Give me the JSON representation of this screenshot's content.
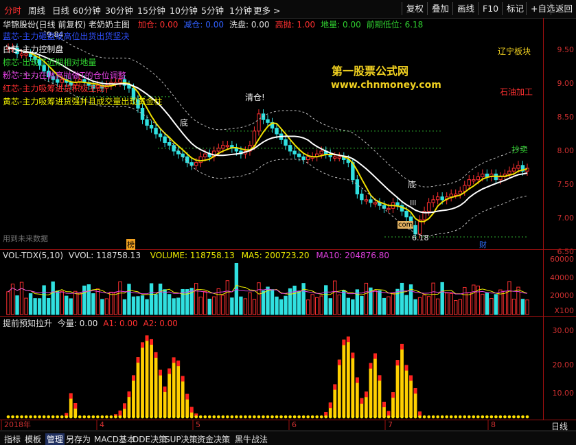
{
  "period_tabs": [
    "分时",
    "周线",
    "日线",
    "60分钟",
    "30分钟",
    "15分钟",
    "10分钟",
    "5分钟",
    "1分钟",
    "更多 >"
  ],
  "active_period": "分时",
  "toolbar_right": [
    "复权",
    "叠加",
    "画线",
    "F10",
    "标记",
    "+自选",
    "返回"
  ],
  "main": {
    "title": "华锦股份(日线 前复权) 老奶奶主图",
    "indicators": [
      {
        "label": "加仓: 0.00",
        "color": "#ff3030"
      },
      {
        "label": "减仓: 0.00",
        "color": "#3060ff"
      },
      {
        "label": "洗盘: 0.00",
        "color": "#e0e0e0"
      },
      {
        "label": "高抛: 1.00",
        "color": "#ff3030"
      },
      {
        "label": "地量: 0.00",
        "color": "#30d030"
      },
      {
        "label": "前期低位: 6.18",
        "color": "#30d030"
      }
    ],
    "legend": [
      {
        "text": "蓝芯-主力砸盘或高位出货出货坚决",
        "color": "#3050ff"
      },
      {
        "text": "白芯-主力控制盘",
        "color": "#f0f0f0"
      },
      {
        "text": "棕芯-出现了近期相对地量",
        "color": "#30d030"
      },
      {
        "text": "粉芯-主力在做高抛做T的仓位调整",
        "color": "#e040e0"
      },
      {
        "text": "红芯-主力吸筹进货积极主动",
        "color": "#ff3030"
      },
      {
        "text": "黄芯-主力吸筹进货强并且成交量出现黄金柱",
        "color": "#f0f000"
      }
    ],
    "watermark_cn": "第一股票公式网",
    "watermark_url": "www.chnmoney.com",
    "sector_1": "辽宁板块",
    "sector_2": "石油加工",
    "annotation_clear": "清仓!",
    "annotation_bottom_1": "底",
    "annotation_bottom_2": "底",
    "annotation_buy": "抄卖",
    "annotation_high_price": "9.84",
    "annotation_low_price": "6.18",
    "annotation_bang": "榜",
    "annotation_cai": "财",
    "annotation_ill": "Ill",
    "annotation_com": "com",
    "annotation_nodata": "用到未来数据",
    "y_ticks": [
      "9.50",
      "9.00",
      "8.50",
      "8.00",
      "7.50",
      "7.00",
      "6.50"
    ]
  },
  "volume": {
    "title": "VOL-TDX(5,10)",
    "vvol": "VVOL: 118758.13",
    "volume": "VOLUME: 118758.13",
    "ma5": "MA5: 200723.20",
    "ma10": "MA10: 204876.80",
    "y_ticks": [
      "60000",
      "40000",
      "20000",
      "X100"
    ]
  },
  "predict": {
    "title": "提前预知拉升",
    "jinliang": "今量: 0.00",
    "a1": "A1: 0.00",
    "a2": "A2: 0.00",
    "y_ticks": [
      "30.00",
      "20.00",
      "10.00"
    ]
  },
  "x_labels": [
    "2018年",
    "4",
    "5",
    "6",
    "7",
    "8"
  ],
  "x_period": "日线",
  "bottom_tabs": [
    "指标",
    "模板",
    "管理",
    "另存为",
    "MACD基本",
    "DDE决策",
    "SUP决策",
    "资金决策",
    "黑牛战法"
  ],
  "active_bottom_tab": "管理",
  "chart_data": {
    "type": "candlestick",
    "y_range": [
      6.3,
      9.9
    ],
    "closes": [
      9.6,
      9.6,
      9.5,
      9.5,
      9.5,
      9.45,
      9.4,
      9.3,
      9.2,
      9.1,
      9.05,
      9.0,
      9.05,
      9.0,
      8.95,
      9.0,
      9.05,
      9.0,
      8.95,
      8.9,
      8.95,
      8.9,
      8.95,
      9.0,
      9.0,
      9.05,
      8.95,
      8.9,
      8.7,
      8.55,
      8.35,
      8.25,
      8.2,
      8.1,
      8.05,
      7.95,
      7.9,
      7.8,
      7.75,
      7.7,
      7.6,
      7.55,
      7.6,
      7.7,
      7.75,
      7.7,
      7.8,
      7.85,
      7.9,
      7.9,
      7.85,
      7.8,
      7.75,
      7.8,
      7.9,
      8.15,
      8.45,
      8.35,
      8.3,
      8.2,
      8.1,
      8.0,
      7.9,
      7.8,
      7.75,
      7.7,
      7.65,
      7.7,
      7.7,
      7.75,
      7.8,
      7.75,
      7.7,
      7.7,
      7.7,
      7.65,
      7.6,
      7.3,
      7.05,
      6.95,
      6.95,
      6.9,
      6.9,
      6.85,
      6.8,
      6.8,
      6.9,
      6.85,
      6.75,
      6.65,
      6.5,
      6.35,
      6.6,
      6.75,
      6.9,
      6.95,
      7.0,
      6.95,
      7.0,
      7.05,
      7.05,
      7.1,
      7.2,
      7.3,
      7.3,
      7.35,
      7.4,
      7.35,
      7.4,
      7.3,
      7.35,
      7.4,
      7.45,
      7.5,
      7.55,
      7.45,
      7.5
    ]
  }
}
